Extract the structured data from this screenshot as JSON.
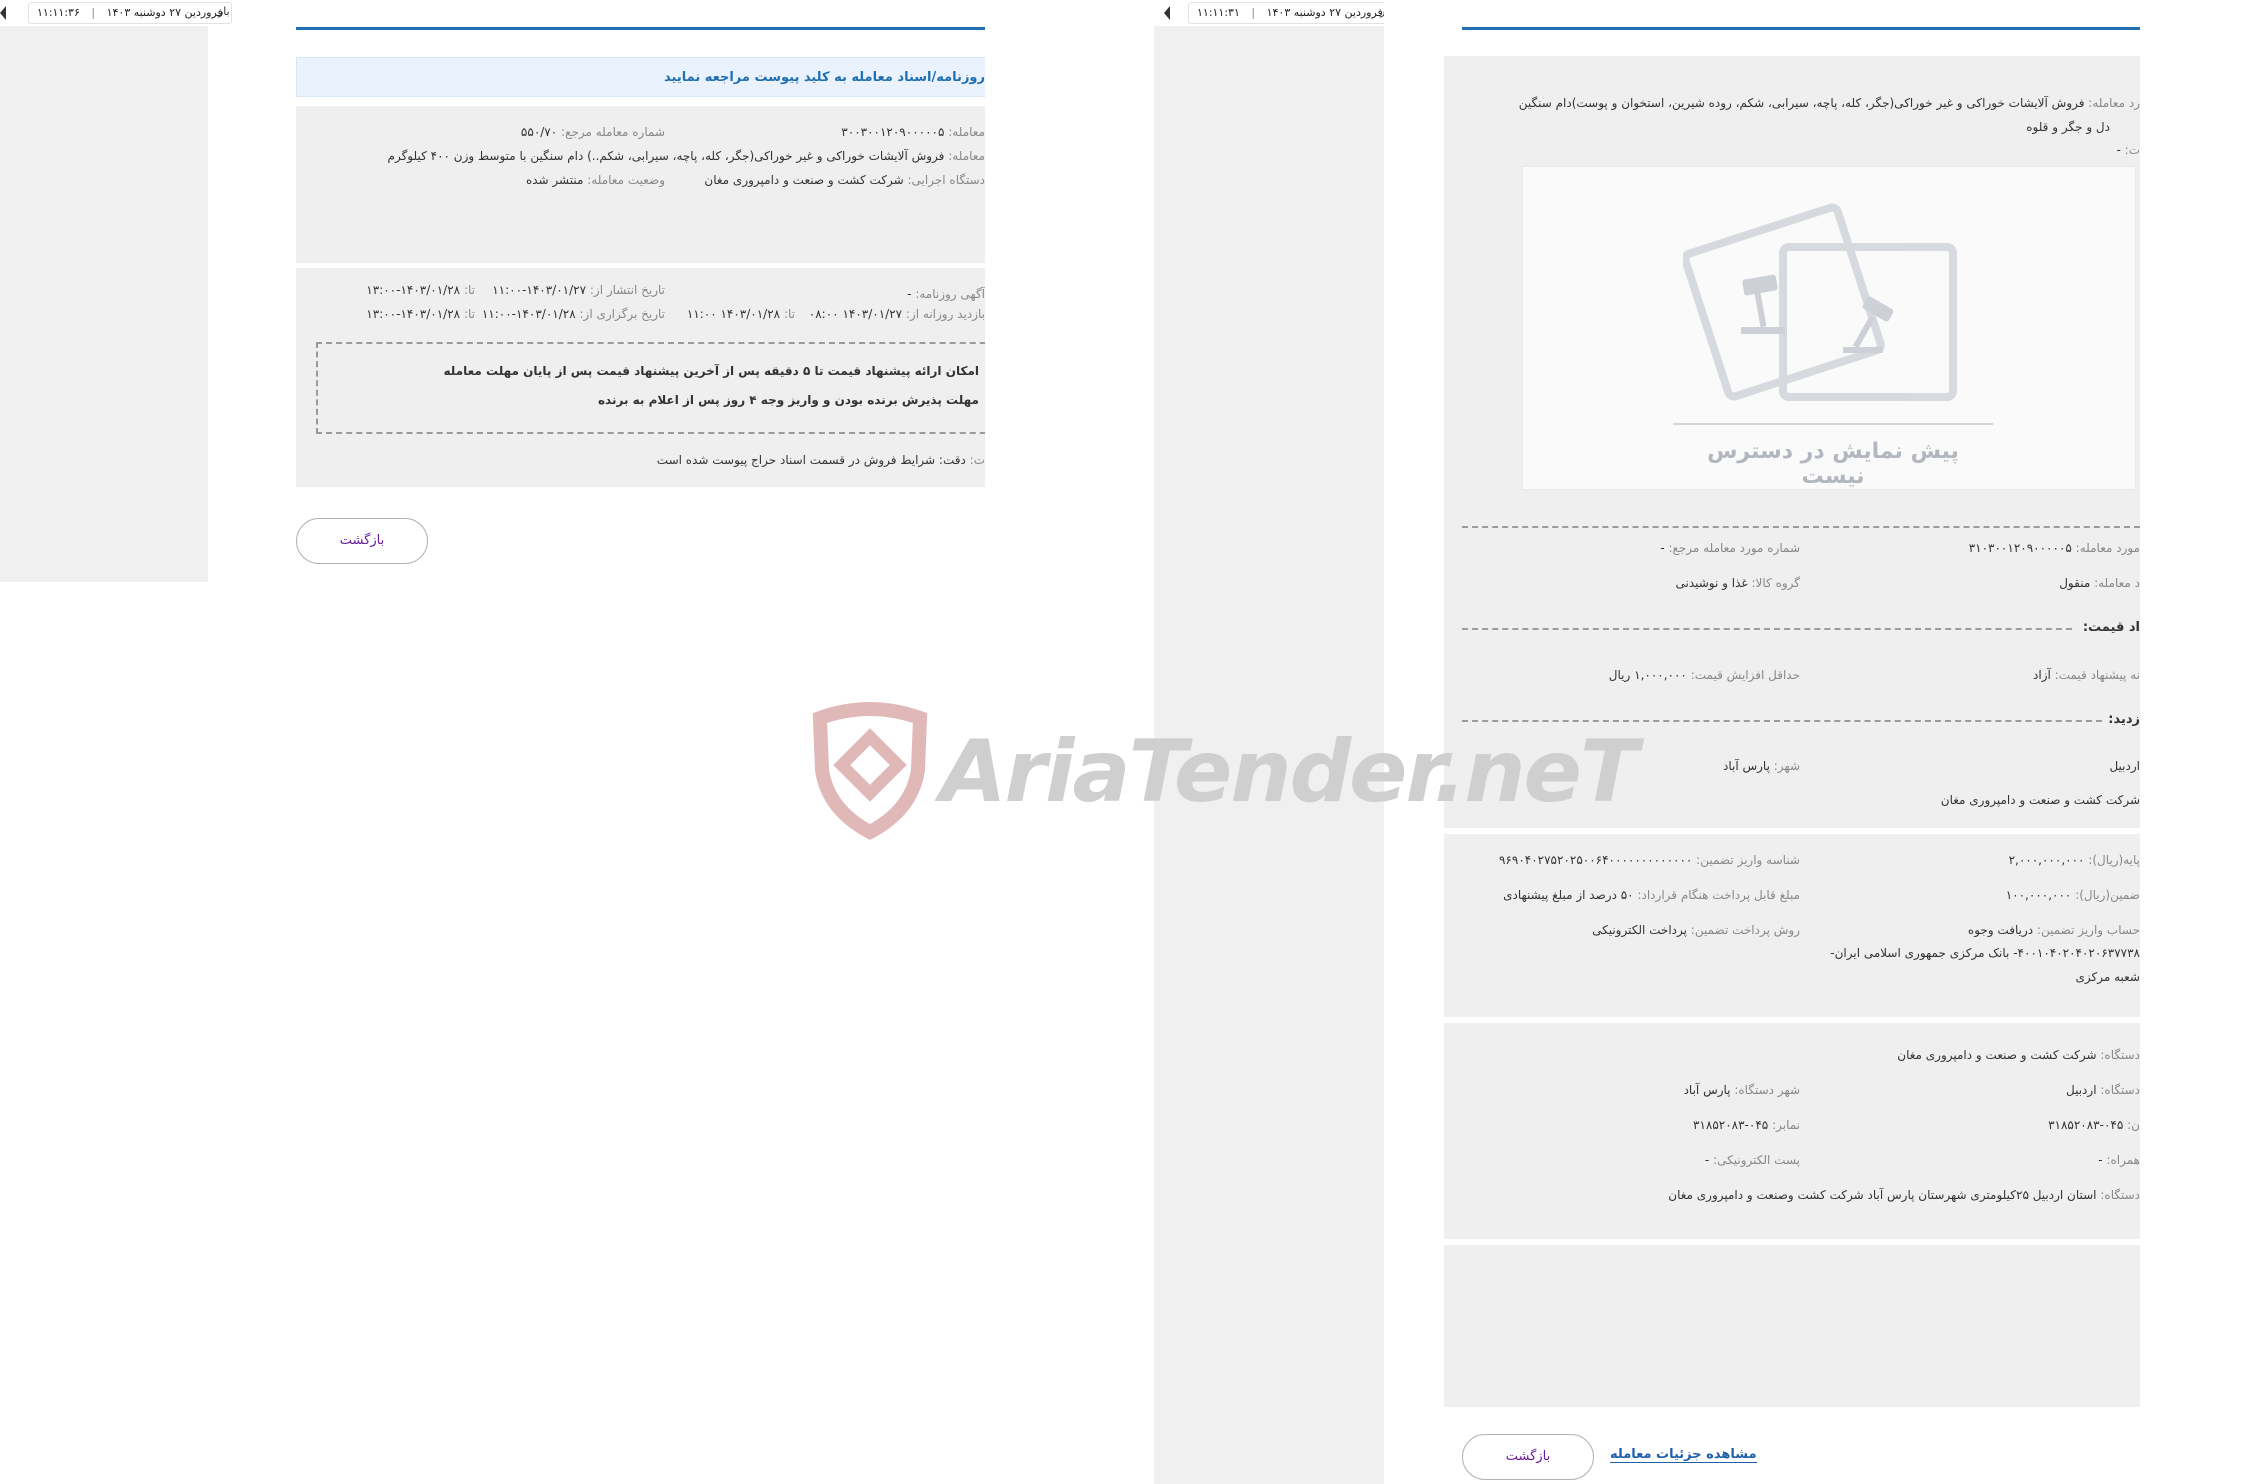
{
  "panel1": {
    "topbar": {
      "date": "فروردین ۲۷ دوشنبه ۱۴۰۳",
      "time": "۱۱:۱۱:۳۶",
      "tail": "بار"
    },
    "notice": "روزنامه/اسناد معامله به کلید پیوست مراجعه نمایید",
    "info": {
      "deal_no_label": "معامله:",
      "deal_no": "۳۰۰۳۰۰۱۲۰۹۰۰۰۰۰۵",
      "ref_no_label": "شماره معامله مرجع:",
      "ref_no": "۵۵۰/۷۰",
      "subject_label": "معامله:",
      "subject": "فروش آلایشات خوراکی و غیر خوراکی(جگر، کله، پاچه، سیرابی، شکم..) دام سنگین با متوسط وزن ۴۰۰ کیلوگرم",
      "org_label": "دستگاه اجرایی:",
      "org": "شرکت کشت و صنعت و دامپروری مغان",
      "status_label": "وضعیت معامله:",
      "status": "منتشر شده"
    },
    "schedule": {
      "ad_label": "آگهی روزنامه:",
      "ad": "-",
      "pub_from_label": "تاریخ انتشار از:",
      "pub_from": "۱۴۰۳/۰۱/۲۷-۱۱:۰۰",
      "pub_to_label": "تا:",
      "pub_to": "۱۴۰۳/۰۱/۲۸-۱۳:۰۰",
      "visit_from_label": "بازدید روزانه از:",
      "visit_from": "۱۴۰۳/۰۱/۲۷ ۰۸:۰۰",
      "visit_to_label": "تا:",
      "visit_to": "۱۴۰۳/۰۱/۲۸ ۱۱:۰۰",
      "hold_from_label": "تاریخ برگزاری از:",
      "hold_from": "۱۴۰۳/۰۱/۲۸-۱۱:۰۰",
      "hold_to_label": "تا:",
      "hold_to": "۱۴۰۳/۰۱/۲۸-۱۳:۰۰"
    },
    "notes": {
      "line1": "امکان ارائه پیشنهاد قیمت تا ۵ دقیقه پس از آخرین پیشنهاد قیمت پس از پایان مهلت معامله",
      "line2": "مهلت پذیرش برنده بودن و واریز وجه ۴ روز پس از اعلام به برنده"
    },
    "remark_label": "ت:",
    "remark": "دقت: شرایط فروش در قسمت اسناد حراج پیوست شده است",
    "back_button": "بازگشت"
  },
  "panel2": {
    "topbar": {
      "date": "فروردین ۲۷ دوشنبه ۱۴۰۳",
      "time": "۱۱:۱۱:۳۱",
      "tail": "بار"
    },
    "subject_label": "رد معامله:",
    "subject": "فروش آلایشات خوراکی و غیر خوراکی(جگر، کله، پاچه، سیرابی، شکم، روده شیرین، استخوان و پوست)دام سنگین",
    "subject2": "دل و جگر و قلوه",
    "desc_label": "ت:",
    "desc": "-",
    "preview_text": "پیش نمایش در دسترس نیست",
    "item_no_label": "مورد معامله:",
    "item_no": "۳۱۰۳۰۰۱۲۰۹۰۰۰۰۰۵",
    "ref_item_label": "شماره مورد معامله مرجع:",
    "ref_item": "-",
    "type_label": "د معامله:",
    "type": "منقول",
    "group_label": "گروه کالا:",
    "group": "غذا و نوشیدنی",
    "price_title": "اد قیمت:",
    "offer_label": "نه پیشنهاد قیمت:",
    "offer": "آزاد",
    "min_inc_label": "حداقل افزایش قیمت:",
    "min_inc": "۱,۰۰۰,۰۰۰ ریال",
    "visit_title": "زدید:",
    "province": "اردبیل",
    "city_label": "شهر:",
    "city": "پارس آباد",
    "visit_org": "شرکت کشت و صنعت و دامپروری مغان",
    "base_label": "پایه(ریال):",
    "base": "۲,۰۰۰,۰۰۰,۰۰۰",
    "guarantee_id_label": "شناسه واریز تضمین:",
    "guarantee_id": "۹۶۹۰۴۰۲۷۵۲۰۲۵۰۰۶۴۰۰۰۰۰۰۰۰۰۰۰۰۰",
    "guarantee_label": "ضمین(ریال):",
    "guarantee": "۱۰۰,۰۰۰,۰۰۰",
    "pay_label": "مبلغ قابل پرداخت هنگام قرارداد:",
    "pay": "۵۰ درصد از مبلغ پیشنهادی",
    "account_label": "حساب واریز تضمین:",
    "account": "دریافت وجوه",
    "method_label": "روش پرداخت تضمین:",
    "method": "پرداخت الکترونیکی",
    "bank": "۴۰۰۱۰۴۰۲۰۴۰۲۰۶۳۷۷۳۸- بانک مرکزی جمهوری اسلامی ایران-",
    "branch": "شعبه مرکزی",
    "org_label": "دستگاه:",
    "org": "شرکت کشت و صنعت و دامپروری مغان",
    "org_prov_label": "دستگاه:",
    "org_prov": "اردبیل",
    "org_city_label": "شهر دستگاه:",
    "org_city": "پارس آباد",
    "phone_label": "ن:",
    "phone": "۰۴۵-۳۱۸۵۲۰۸۳",
    "fax_label": "نمابر:",
    "fax": "۰۴۵-۳۱۸۵۲۰۸۳",
    "mobile_label": "همراه:",
    "mobile": "-",
    "email_label": "پست الکترونیکی:",
    "email": "-",
    "address_label": "دستگاه:",
    "address": "استان اردبیل ۲۵کیلومتری شهرستان پارس آباد شرکت کشت وصنعت و دامپروری مغان",
    "details_link": "مشاهده جزئیات معامله",
    "back_button": "بازگشت"
  },
  "watermark": "AriaTender.neT",
  "colors": {
    "accent": "#1f6fb2",
    "button_text": "#6a1b9a",
    "panel_gray": "#efefef",
    "watermark": "#d9a6a6"
  }
}
